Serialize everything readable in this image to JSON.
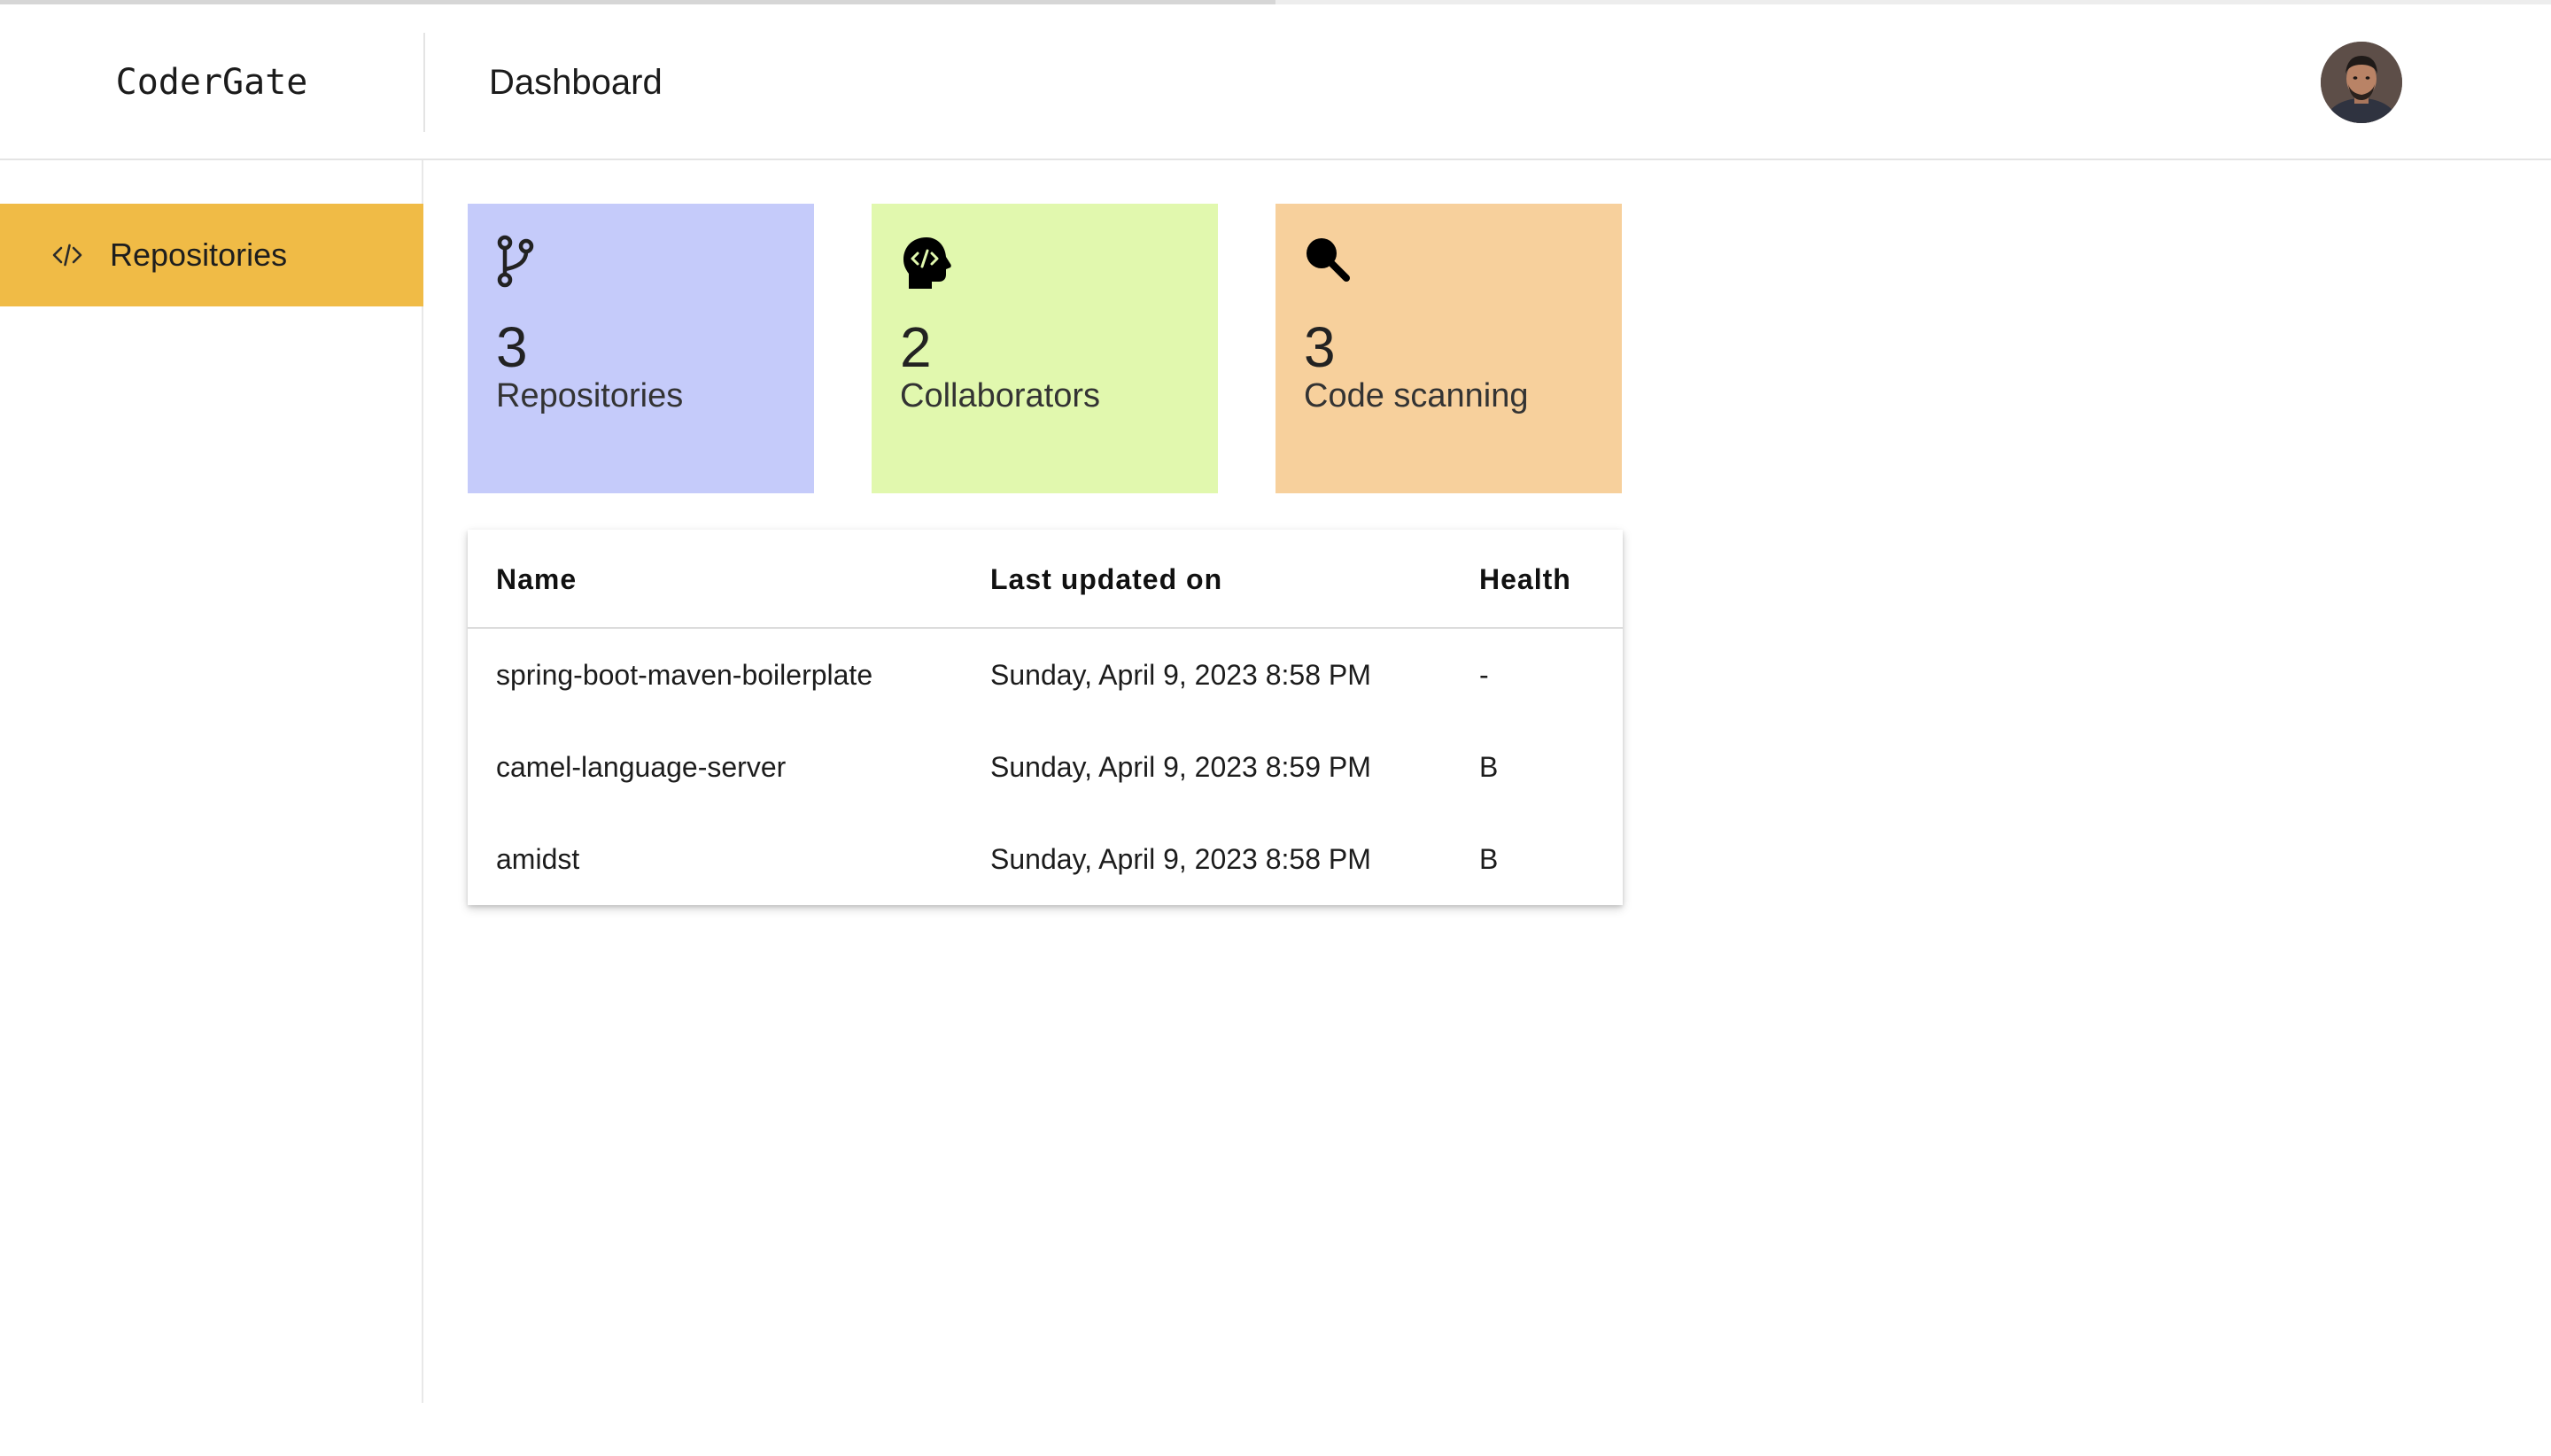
{
  "header": {
    "brand": "CoderGate",
    "title": "Dashboard",
    "avatar_alt": "User avatar"
  },
  "sidebar": {
    "items": [
      {
        "label": "Repositories",
        "icon": "code-icon",
        "active": true
      }
    ]
  },
  "stats": [
    {
      "count": "3",
      "label": "Repositories",
      "icon": "git-branch-icon",
      "color": "#c5cbfa"
    },
    {
      "count": "2",
      "label": "Collaborators",
      "icon": "head-code-icon",
      "color": "#e1f8ae"
    },
    {
      "count": "3",
      "label": "Code scanning",
      "icon": "search-icon",
      "color": "#f7d09c"
    }
  ],
  "table": {
    "columns": [
      "Name",
      "Last updated on",
      "Health"
    ],
    "rows": [
      {
        "name": "spring-boot-maven-boilerplate",
        "updated": "Sunday, April 9, 2023 8:58 PM",
        "health": "-"
      },
      {
        "name": "camel-language-server",
        "updated": "Sunday, April 9, 2023 8:59 PM",
        "health": "B"
      },
      {
        "name": "amidst",
        "updated": "Sunday, April 9, 2023 8:58 PM",
        "health": "B"
      }
    ]
  },
  "colors": {
    "accent": "#f0bb46"
  }
}
